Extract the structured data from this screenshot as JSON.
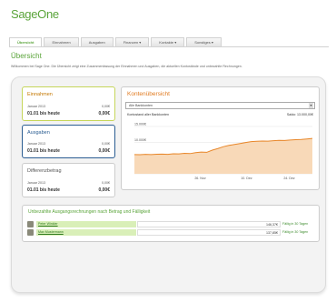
{
  "app": {
    "logo_part1": "Sage",
    "logo_part2": "One"
  },
  "tabs": [
    {
      "label": "Übersicht"
    },
    {
      "label": "Einnahmen"
    },
    {
      "label": "Ausgaben"
    },
    {
      "label": "Finanzen ▾"
    },
    {
      "label": "Kontakte ▾"
    },
    {
      "label": "Sonstiges ▾"
    }
  ],
  "page": {
    "title": "Übersicht",
    "intro": "Willkommen bei Sage One. Die Übersicht zeigt eine Zusammenfassung der Einnahmen und Ausgaben, die aktuellen Kontostände und unbezahlte Rechnungen."
  },
  "cards": {
    "income": {
      "title": "Einnahmen",
      "period": "Januar 2013",
      "period_value": "0,00€",
      "total_label": "01.01 bis heute",
      "total_value": "0,00€"
    },
    "expense": {
      "title": "Ausgaben",
      "period": "Januar 2013",
      "period_value": "0,00€",
      "total_label": "01.01 bis heute",
      "total_value": "0,00€"
    },
    "diff": {
      "title": "Differenzbetrag",
      "period": "Januar 2013",
      "period_value": "0,00€",
      "total_label": "01.01 bis heute",
      "total_value": "0,00€"
    }
  },
  "overview": {
    "title": "Kontenübersicht",
    "select_value": "Alle Bankkonten",
    "sum_label": "Kontostand aller Bankkonten",
    "saldo_label": "Saldo: 13.000,00€"
  },
  "chart_data": {
    "type": "area",
    "yticks": [
      "15.000€",
      "10.000€",
      "5.000€",
      "0€"
    ],
    "xticks": [
      "26. Nov",
      "10. Dez",
      "24. Dez"
    ],
    "ylim": [
      0,
      15000
    ],
    "values": [
      6100,
      6050,
      6150,
      6100,
      6200,
      6250,
      6150,
      6350,
      6300,
      6500,
      6400,
      6700,
      6900,
      6800,
      7500,
      8000,
      8600,
      9000,
      9300,
      9600,
      9900,
      10200,
      10300,
      10400,
      10350,
      10500,
      10600,
      10550,
      10700,
      10800,
      10900,
      11050,
      11200
    ],
    "color": "#e8872a",
    "fill": "#f8d9b8"
  },
  "unpaid": {
    "title": "Unbezahlte Ausgangsrechnungen nach Betrag und Fälligkeit",
    "rows": [
      {
        "name": "Peter Winkler",
        "amount": "146,37€",
        "due": "Fällig in 30 Tagen"
      },
      {
        "name": "Max Mustermann",
        "amount": "137,85€",
        "due": "Fällig in 30 Tagen"
      }
    ]
  }
}
